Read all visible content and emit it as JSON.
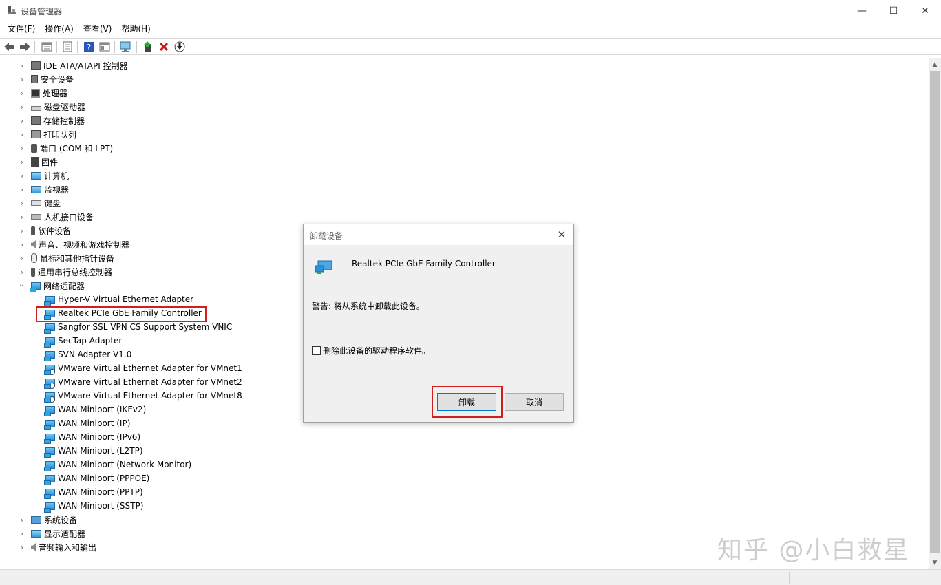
{
  "window": {
    "title": "设备管理器",
    "min_glyph": "—",
    "max_glyph": "☐",
    "close_glyph": "✕"
  },
  "menu": [
    {
      "label": "文件(F)"
    },
    {
      "label": "操作(A)"
    },
    {
      "label": "查看(V)"
    },
    {
      "label": "帮助(H)"
    }
  ],
  "toolbar": {
    "icons": [
      "back-icon",
      "forward-icon",
      "properties-pane-icon",
      "properties-icon",
      "help-icon",
      "view-icon",
      "monitor-scan-icon",
      "update-driver-icon",
      "uninstall-icon",
      "download-icon"
    ]
  },
  "tree": {
    "categories": [
      {
        "label": "IDE ATA/ATAPI 控制器",
        "expanded": false
      },
      {
        "label": "安全设备",
        "expanded": false
      },
      {
        "label": "处理器",
        "expanded": false
      },
      {
        "label": "磁盘驱动器",
        "expanded": false
      },
      {
        "label": "存储控制器",
        "expanded": false
      },
      {
        "label": "打印队列",
        "expanded": false
      },
      {
        "label": "端口 (COM 和 LPT)",
        "expanded": false
      },
      {
        "label": "固件",
        "expanded": false
      },
      {
        "label": "计算机",
        "expanded": false
      },
      {
        "label": "监视器",
        "expanded": false
      },
      {
        "label": "键盘",
        "expanded": false
      },
      {
        "label": "人机接口设备",
        "expanded": false
      },
      {
        "label": "软件设备",
        "expanded": false
      },
      {
        "label": "声音、视频和游戏控制器",
        "expanded": false
      },
      {
        "label": "鼠标和其他指针设备",
        "expanded": false
      },
      {
        "label": "通用串行总线控制器",
        "expanded": false
      },
      {
        "label": "网络适配器",
        "expanded": true
      }
    ],
    "network_adapters": [
      {
        "label": "Hyper-V Virtual Ethernet Adapter"
      },
      {
        "label": "Realtek PCIe GbE Family Controller",
        "highlighted": true
      },
      {
        "label": "Sangfor SSL VPN CS Support System VNIC"
      },
      {
        "label": "SecTap Adapter"
      },
      {
        "label": "SVN Adapter V1.0"
      },
      {
        "label": "VMware Virtual Ethernet Adapter for VMnet1"
      },
      {
        "label": "VMware Virtual Ethernet Adapter for VMnet2"
      },
      {
        "label": "VMware Virtual Ethernet Adapter for VMnet8"
      },
      {
        "label": "WAN Miniport (IKEv2)"
      },
      {
        "label": "WAN Miniport (IP)"
      },
      {
        "label": "WAN Miniport (IPv6)"
      },
      {
        "label": "WAN Miniport (L2TP)"
      },
      {
        "label": "WAN Miniport (Network Monitor)"
      },
      {
        "label": "WAN Miniport (PPPOE)"
      },
      {
        "label": "WAN Miniport (PPTP)"
      },
      {
        "label": "WAN Miniport (SSTP)"
      }
    ],
    "trailing_categories": [
      {
        "label": "系统设备",
        "expanded": false
      },
      {
        "label": "显示适配器",
        "expanded": false
      },
      {
        "label": "音频输入和输出",
        "expanded": false
      }
    ]
  },
  "dialog": {
    "title": "卸载设备",
    "device_name": "Realtek PCIe GbE Family Controller",
    "warning": "警告: 将从系统中卸载此设备。",
    "checkbox_label": "删除此设备的驱动程序软件。",
    "checkbox_checked": false,
    "uninstall_label": "卸载",
    "cancel_label": "取消",
    "close_glyph": "✕"
  },
  "watermark": "知乎 @小白救星",
  "colors": {
    "highlight_box": "#d21e1e",
    "dialog_bg": "#f0f0f0",
    "focus_border": "#0078d7"
  }
}
